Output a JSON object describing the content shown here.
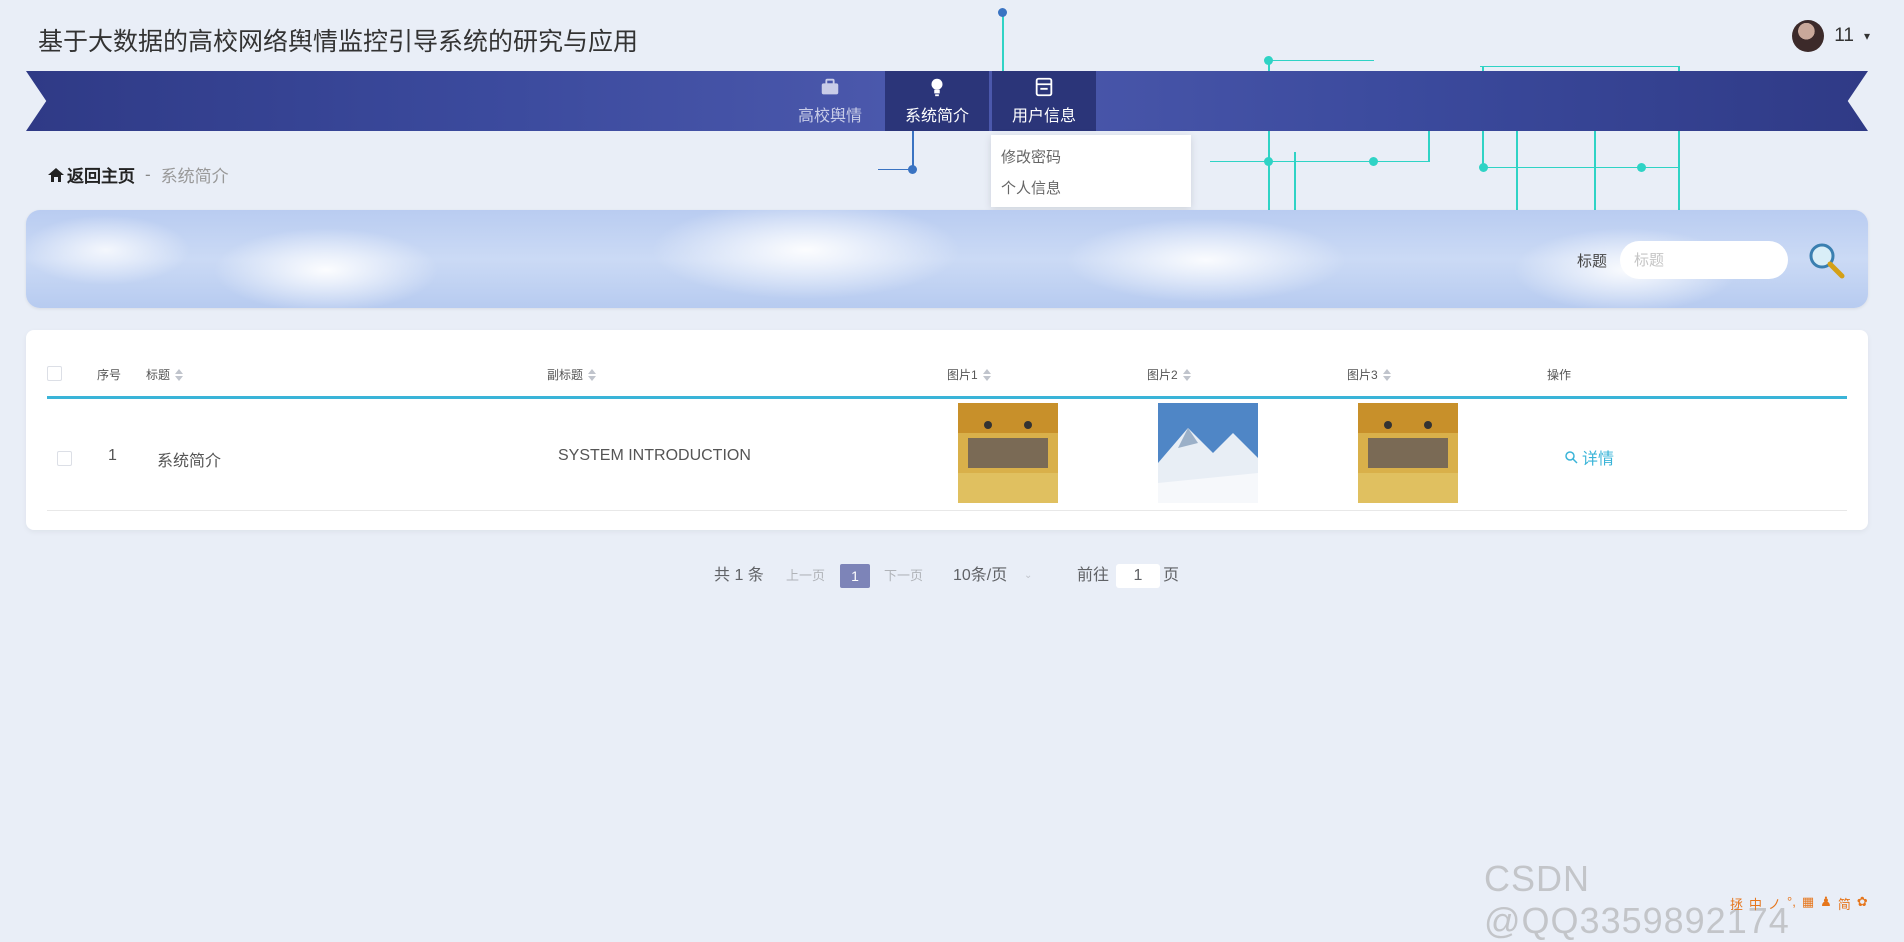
{
  "app": {
    "title": "基于大数据的高校网络舆情监控引导系统的研究与应用"
  },
  "user": {
    "name": "11",
    "caret": "▾"
  },
  "nav": {
    "items": [
      {
        "label": "高校舆情",
        "icon": "briefcase-icon"
      },
      {
        "label": "系统简介",
        "icon": "lightbulb-icon"
      },
      {
        "label": "用户信息",
        "icon": "user-card-icon"
      }
    ]
  },
  "user_menu": {
    "items": [
      "修改密码",
      "个人信息"
    ]
  },
  "breadcrumb": {
    "home": "返回主页",
    "separator": "-",
    "current": "系统简介"
  },
  "search": {
    "label": "标题",
    "placeholder": "标题",
    "button_icon": "search-icon"
  },
  "table": {
    "columns": [
      "序号",
      "标题",
      "副标题",
      "图片1",
      "图片2",
      "图片3",
      "操作"
    ],
    "rows": [
      {
        "index": "1",
        "title": "系统简介",
        "subtitle": "SYSTEM INTRODUCTION",
        "images": [
          "office-photo",
          "snow-mountain-photo",
          "office-photo"
        ],
        "action": "详情"
      }
    ]
  },
  "pagination": {
    "total": "共 1 条",
    "prev": "上一页",
    "current": "1",
    "next": "下一页",
    "page_size": "10条/页",
    "goto_label": "前往",
    "goto_value": "1",
    "page_suffix": "页"
  },
  "watermark": "CSDN @QQ3359892174",
  "ime_bar": [
    "拯",
    "中",
    "ノ",
    "°,",
    "▦",
    "♟",
    "简",
    "✿"
  ],
  "colors": {
    "nav_bg": "#3b4a9d",
    "nav_active": "#2b3579",
    "accent": "#3ab4d8",
    "page_bg": "#e9eef7",
    "circuit": "#2fd3c5"
  }
}
